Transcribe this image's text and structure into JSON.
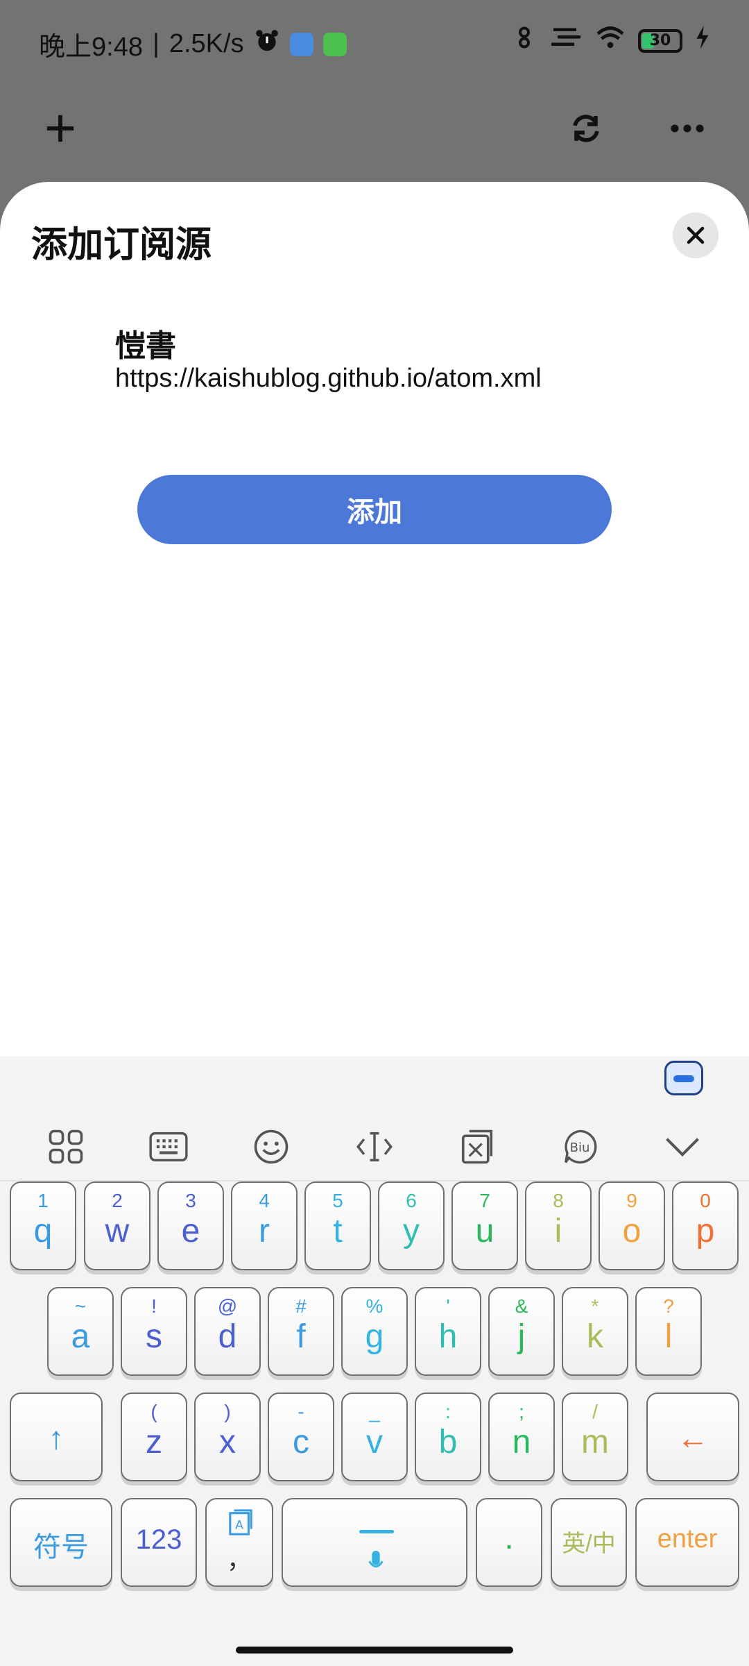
{
  "status_bar": {
    "time": "晚上9:48",
    "speed": "2.5K/s",
    "battery": "30"
  },
  "sheet": {
    "title": "添加订阅源",
    "feed_name": "愷書",
    "feed_url": "https://kaishublog.github.io/atom.xml",
    "add_label": "添加"
  },
  "keyboard": {
    "row1": [
      {
        "sub": "1",
        "main": "q",
        "color": "#3a9be0"
      },
      {
        "sub": "2",
        "main": "w",
        "color": "#4b5fd1"
      },
      {
        "sub": "3",
        "main": "e",
        "color": "#4b5fd1"
      },
      {
        "sub": "4",
        "main": "r",
        "color": "#3a9be0"
      },
      {
        "sub": "5",
        "main": "t",
        "color": "#35b3e0"
      },
      {
        "sub": "6",
        "main": "y",
        "color": "#2fbfb0"
      },
      {
        "sub": "7",
        "main": "u",
        "color": "#2bb85c"
      },
      {
        "sub": "8",
        "main": "i",
        "color": "#a8bd5a"
      },
      {
        "sub": "9",
        "main": "o",
        "color": "#f0a040"
      },
      {
        "sub": "0",
        "main": "p",
        "color": "#f07030"
      }
    ],
    "row2": [
      {
        "sub": "~",
        "main": "a",
        "color": "#3a9be0"
      },
      {
        "sub": "!",
        "main": "s",
        "color": "#4b5fd1"
      },
      {
        "sub": "@",
        "main": "d",
        "color": "#4b5fd1"
      },
      {
        "sub": "#",
        "main": "f",
        "color": "#3a9be0"
      },
      {
        "sub": "%",
        "main": "g",
        "color": "#35b3e0"
      },
      {
        "sub": "'",
        "main": "h",
        "color": "#2fbfb0"
      },
      {
        "sub": "&",
        "main": "j",
        "color": "#2bb85c"
      },
      {
        "sub": "*",
        "main": "k",
        "color": "#a8bd5a"
      },
      {
        "sub": "?",
        "main": "l",
        "color": "#f0a040"
      }
    ],
    "row3": [
      {
        "sub": "(",
        "main": "z",
        "color": "#4b5fd1"
      },
      {
        "sub": ")",
        "main": "x",
        "color": "#4b5fd1"
      },
      {
        "sub": "-",
        "main": "c",
        "color": "#3a9be0"
      },
      {
        "sub": "_",
        "main": "v",
        "color": "#35b3e0"
      },
      {
        "sub": ":",
        "main": "b",
        "color": "#2fbfb0"
      },
      {
        "sub": ";",
        "main": "n",
        "color": "#2bb85c"
      },
      {
        "sub": "/",
        "main": "m",
        "color": "#a8bd5a"
      }
    ],
    "shift_label": "↑",
    "backspace_label": "←",
    "symbols_label": "符号",
    "numbers_label": "123",
    "comma_label": "，",
    "period_label": ".",
    "lang_label": "英/中",
    "enter_label": "enter"
  }
}
